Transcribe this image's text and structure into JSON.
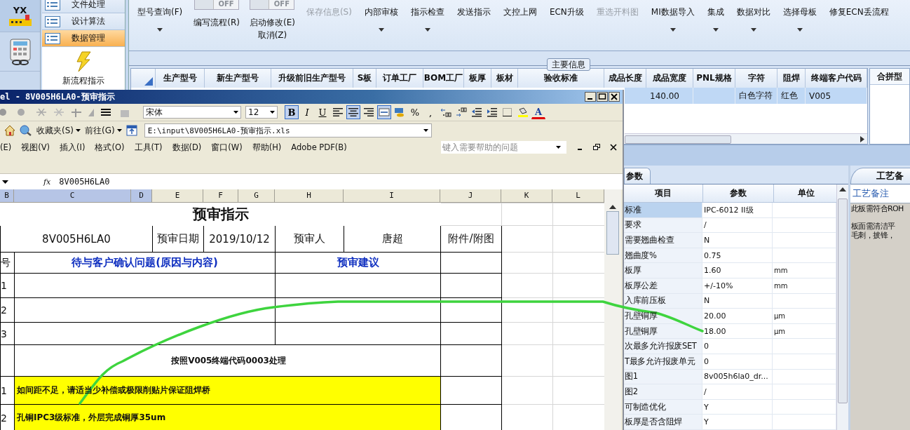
{
  "app_sidebar": {
    "logo_text": "YX"
  },
  "nav": {
    "items": [
      {
        "label": "文件处理",
        "selected": false
      },
      {
        "label": "设计算法",
        "selected": false
      },
      {
        "label": "数据管理",
        "selected": true
      }
    ],
    "action": "新流程指示"
  },
  "ribbon": [
    {
      "kind": "button",
      "label": "型号查询(F)",
      "disabled": false,
      "dropdown": true
    },
    {
      "kind": "toggle",
      "toggle_text": "OFF",
      "on": false,
      "label": "编写流程(R)"
    },
    {
      "kind": "toggle",
      "toggle_text": "OFF",
      "on": false,
      "label": "启动修改(E)",
      "label2": "取消(Z)"
    },
    {
      "kind": "button",
      "label": "保存信息(S)",
      "disabled": true,
      "dropdown": false
    },
    {
      "kind": "button",
      "label": "内部审核",
      "disabled": false,
      "dropdown": true
    },
    {
      "kind": "button",
      "label": "指示检查",
      "disabled": false,
      "dropdown": true
    },
    {
      "kind": "button",
      "label": "发送指示",
      "disabled": false,
      "dropdown": false
    },
    {
      "kind": "button",
      "label": "文控上网",
      "disabled": false,
      "dropdown": false
    },
    {
      "kind": "button",
      "label": "ECN升级",
      "disabled": false,
      "dropdown": false
    },
    {
      "kind": "button",
      "label": "重选开料图",
      "disabled": true,
      "dropdown": false
    },
    {
      "kind": "button",
      "label": "MI数据导入",
      "disabled": false,
      "dropdown": true
    },
    {
      "kind": "button",
      "label": "集成",
      "disabled": false,
      "dropdown": true
    },
    {
      "kind": "button",
      "label": "数据对比",
      "disabled": false,
      "dropdown": true
    },
    {
      "kind": "button",
      "label": "选择母板",
      "disabled": false,
      "dropdown": true
    },
    {
      "kind": "button",
      "label": "修复ECN丢流程",
      "disabled": false,
      "dropdown": false
    }
  ],
  "main_info": {
    "title": "主要信息",
    "columns": [
      "生产型号",
      "新生产型号",
      "升级前旧生产型号",
      "S板",
      "订单工厂",
      "BOM工厂",
      "板厚",
      "板材",
      "验收标准",
      "成品长度",
      "成品宽度",
      "PNL规格",
      "字符",
      "阻焊",
      "终端客户代码"
    ],
    "rows": [
      {
        "selected": true,
        "cells": [
          null,
          null,
          null,
          null,
          null,
          null,
          null,
          null,
          null,
          null,
          "140.00",
          null,
          "白色字符",
          "红色",
          "V005"
        ]
      }
    ],
    "side_column": "合拼型"
  },
  "params": {
    "tab": {
      "label": "参数",
      "selected": true
    },
    "columns": [
      "项目",
      "参数",
      "单位"
    ],
    "rows": [
      {
        "name": "标准",
        "value": "IPC-6012 II级",
        "selected": true
      },
      {
        "name": "要求",
        "value": "/",
        "selected": false
      },
      {
        "name": "需要翘曲检查",
        "value": "N",
        "selected": false
      },
      {
        "name": "翘曲度%",
        "value": "0.75",
        "selected": false
      },
      {
        "name": "板厚",
        "value": "1.60",
        "unit": "mm",
        "selected": false
      },
      {
        "name": "板厚公差",
        "value": "+/-10%",
        "unit": "mm",
        "selected": false
      },
      {
        "name": "入库前压板",
        "value": "N",
        "selected": false
      },
      {
        "name": "孔壁铜厚",
        "value": "20.00",
        "unit": "µm",
        "selected": false
      },
      {
        "name": "孔壁铜厚",
        "value": "18.00",
        "unit": "µm",
        "selected": false
      },
      {
        "name": "次最多允许报废SET",
        "value": "0",
        "selected": false
      },
      {
        "name": "T最多允许报废单元",
        "value": "0",
        "selected": false
      },
      {
        "name": "图1",
        "value": "8v005h6la0_dr...",
        "selected": false
      },
      {
        "name": "图2",
        "value": "/",
        "selected": false
      },
      {
        "name": "可制造优化",
        "value": "Y",
        "selected": false
      },
      {
        "name": "板厚是否含阻焊",
        "value": "Y",
        "selected": false
      }
    ]
  },
  "notes": {
    "tab": "工艺备",
    "header": "工艺备注",
    "lines": [
      "此板需符合ROH",
      "板面需清洁平",
      "毛刺，披锋，"
    ]
  },
  "excel": {
    "title": "el - 8V005H6LA0-预审指示",
    "font": "宋体",
    "font_size": "12",
    "format_buttons": [
      {
        "kind": "text",
        "label": "B",
        "on": true
      },
      {
        "kind": "text",
        "label": "I",
        "on": false
      },
      {
        "kind": "text",
        "label": "U",
        "on": false
      },
      {
        "kind": "align_left",
        "on": false
      },
      {
        "kind": "align_center",
        "on": true
      },
      {
        "kind": "align_right",
        "on": false
      },
      {
        "kind": "merge",
        "on": true
      },
      {
        "kind": "currency",
        "on": false
      },
      {
        "kind": "text",
        "label": "%",
        "on": false
      },
      {
        "kind": "text",
        "label": ",",
        "on": false
      },
      {
        "kind": "increase_decimal",
        "on": false
      },
      {
        "kind": "decrease_decimal",
        "on": false
      },
      {
        "kind": "outdent",
        "on": false
      },
      {
        "kind": "indent",
        "on": false
      },
      {
        "kind": "borders",
        "on": false
      },
      {
        "kind": "fill_color",
        "on": false
      },
      {
        "kind": "font_color",
        "label": "A",
        "on": false
      }
    ],
    "favorites": "收藏夹(S)",
    "go": "前往(G)",
    "address": "E:\\input\\8V005H6LA0-预审指示.xls",
    "menu": [
      "(E)",
      "视图(V)",
      "插入(I)",
      "格式(O)",
      "工具(T)",
      "数据(D)",
      "窗口(W)",
      "帮助(H)",
      "Adobe PDF(B)"
    ],
    "help_placeholder": "键入需要帮助的问题",
    "formula": {
      "fx": "fx",
      "value": "8V005H6LA0"
    },
    "column_headers": [
      {
        "label": "B",
        "selected": true
      },
      {
        "label": "C",
        "selected": true
      },
      {
        "label": "D",
        "selected": true
      },
      {
        "label": "E",
        "selected": false
      },
      {
        "label": "F",
        "selected": false
      },
      {
        "label": "G",
        "selected": false
      },
      {
        "label": "H",
        "selected": false
      },
      {
        "label": "I",
        "selected": false
      },
      {
        "label": "J",
        "selected": false
      },
      {
        "label": "K",
        "selected": false
      },
      {
        "label": "L",
        "selected": false
      }
    ],
    "sheet": {
      "title": "预审指示",
      "info": {
        "part_no": "8V005H6LA0",
        "date_label": "预审日期",
        "date": "2019/10/12",
        "reviewer_label": "预审人",
        "reviewer": "唐超",
        "attachment_label": "附件/附图"
      },
      "question_header": {
        "index": "号",
        "question": "待与客户确认问题(原因与内容)",
        "advice": "预审建议"
      },
      "question_rows": [
        {
          "index": "1"
        },
        {
          "index": "2"
        },
        {
          "index": "3"
        }
      ],
      "note": "按照V005终端代码0003处理",
      "highlight_rows": [
        {
          "index": "1",
          "text": "如间距不足，请适当少补偿或极限削贴片保证阻焊桥"
        },
        {
          "index": "2",
          "text": "孔铜IPC3级标准，外层完成铜厚35um"
        }
      ]
    }
  }
}
